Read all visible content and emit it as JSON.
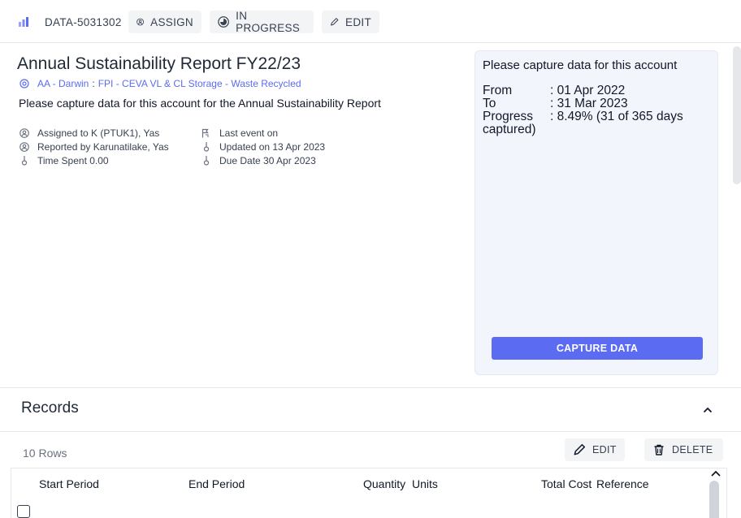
{
  "toolbar": {
    "record_id": "DATA-5031302",
    "assign_label": "ASSIGN",
    "status_label": "IN PROGRESS",
    "edit_label": "EDIT"
  },
  "header": {
    "title": "Annual Sustainability Report FY22/23",
    "breadcrumb": [
      "AA - Darwin",
      "FPI - CEVA VL & CL Storage - Waste Recycled"
    ],
    "breadcrumb_sep": ":",
    "description": "Please capture data for this account for the Annual Sustainability Report"
  },
  "meta": {
    "assigned_to": "Assigned to K (PTUK1), Yas",
    "reported_by": "Reported by Karunatilake, Yas",
    "time_spent": "Time Spent 0.00",
    "last_event": "Last event on",
    "updated_on": "Updated on 13 Apr 2023",
    "due_date": "Due Date 30 Apr 2023"
  },
  "panel": {
    "title": "Please capture data for this account",
    "from_label": "From",
    "from_value": ": 01 Apr 2022",
    "to_label": "To",
    "to_value": ": 31 Mar 2023",
    "progress_label": "Progress",
    "progress_value": ": 8.49% (31 of 365 days captured)",
    "capture_label": "CAPTURE DATA"
  },
  "records": {
    "title": "Records",
    "row_count": "10 Rows",
    "edit_label": "EDIT",
    "delete_label": "DELETE",
    "columns": [
      "Start Period",
      "End Period",
      "Quantity",
      "Units",
      "Total Cost",
      "Reference"
    ]
  },
  "colors": {
    "accent": "#5b6cf2",
    "panel_bg": "#f3f5fd"
  }
}
